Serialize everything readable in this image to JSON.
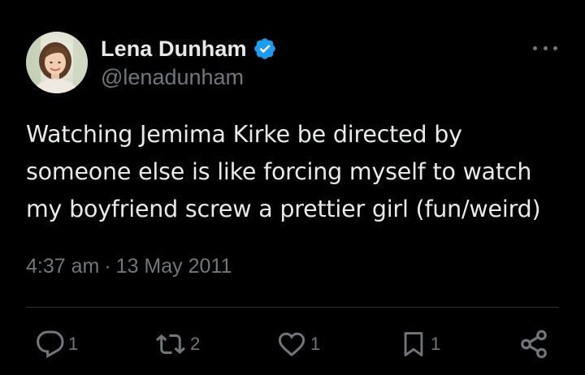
{
  "author": {
    "display_name": "Lena Dunham",
    "handle": "@lenadunham",
    "verified": true,
    "verified_color": "#1d9bf0"
  },
  "tweet": {
    "text_lines": [
      "Watching Jemima Kirke be directed by",
      "someone else is like forcing myself to watch",
      "my boyfriend screw a prettier girl (fun/weird)"
    ],
    "time": "4:37 am",
    "separator": "·",
    "date": "13 May 2011"
  },
  "actions": {
    "replies": "1",
    "retweets": "2",
    "likes": "1",
    "bookmarks": "1"
  },
  "icons": {
    "more": "more-horizontal-icon",
    "reply": "reply-bubble-icon",
    "retweet": "retweet-icon",
    "like": "heart-icon",
    "bookmark": "bookmark-icon",
    "share": "share-icon"
  },
  "colors": {
    "background": "#000000",
    "text": "#e7e9ea",
    "muted": "#71767b",
    "divider": "#2f3336"
  }
}
